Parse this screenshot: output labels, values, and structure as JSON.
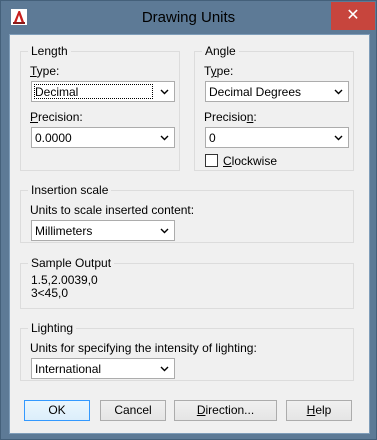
{
  "window": {
    "title": "Drawing Units",
    "close_glyph": "✕"
  },
  "length": {
    "legend": "Length",
    "type_label_pre": "",
    "type_label_u": "T",
    "type_label_post": "ype:",
    "type_value": "Decimal",
    "precision_label_u": "P",
    "precision_label_post": "recision:",
    "precision_value": "0.0000"
  },
  "angle": {
    "legend": "Angle",
    "type_label_pre": "T",
    "type_label_u": "y",
    "type_label_post": "pe:",
    "type_value": "Decimal Degrees",
    "precision_label_pre": "Precisio",
    "precision_label_u": "n",
    "precision_label_post": ":",
    "precision_value": "0",
    "clockwise_u": "C",
    "clockwise_post": "lockwise",
    "clockwise_checked": false
  },
  "insertion": {
    "legend": "Insertion scale",
    "label": "Units to scale inserted content:",
    "value": "Millimeters"
  },
  "sample": {
    "legend": "Sample Output",
    "line1": "1.5,2.0039,0",
    "line2": "3<45,0"
  },
  "lighting": {
    "legend": "Lighting",
    "label": "Units for specifying the intensity of lighting:",
    "value": "International"
  },
  "buttons": {
    "ok": "OK",
    "cancel": "Cancel",
    "direction_u": "D",
    "direction_post": "irection...",
    "help_u": "H",
    "help_post": "elp"
  }
}
